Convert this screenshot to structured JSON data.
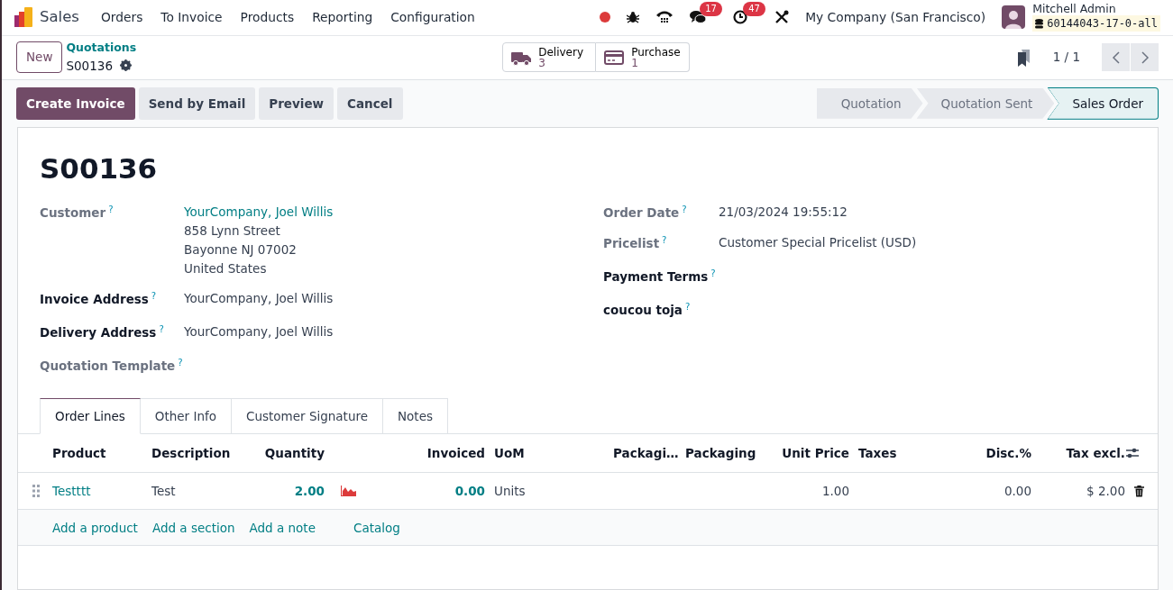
{
  "navbar": {
    "app_name": "Sales",
    "menu": [
      "Orders",
      "To Invoice",
      "Products",
      "Reporting",
      "Configuration"
    ],
    "messages_count": "17",
    "activities_count": "47",
    "company": "My Company (San Francisco)",
    "user_name": "Mitchell Admin",
    "database": "60144043-17-0-all"
  },
  "control_panel": {
    "new_button": "New",
    "breadcrumb": "Quotations",
    "record": "S00136",
    "smart_buttons": [
      {
        "kind": "delivery",
        "label": "Delivery",
        "count": "3"
      },
      {
        "kind": "purchase",
        "label": "Purchase",
        "count": "1"
      }
    ],
    "pager": "1 / 1"
  },
  "action_buttons": [
    {
      "label": "Create Invoice",
      "primary": true
    },
    {
      "label": "Send by Email",
      "primary": false
    },
    {
      "label": "Preview",
      "primary": false
    },
    {
      "label": "Cancel",
      "primary": false
    }
  ],
  "stages": [
    {
      "label": "Quotation",
      "selected": false
    },
    {
      "label": "Quotation Sent",
      "selected": false
    },
    {
      "label": "Sales Order",
      "selected": true
    }
  ],
  "sheet": {
    "title": "S00136",
    "left_fields": [
      {
        "label": "Customer",
        "help": "?",
        "required": false,
        "link": true,
        "value": [
          "YourCompany, Joel Willis",
          "858 Lynn Street",
          "Bayonne NJ 07002",
          "United States"
        ]
      },
      {
        "label": "Invoice Address",
        "help": "?",
        "required": true,
        "link": false,
        "value": [
          "YourCompany, Joel Willis"
        ]
      },
      {
        "label": "Delivery Address",
        "help": "?",
        "required": true,
        "link": false,
        "value": [
          "YourCompany, Joel Willis"
        ]
      },
      {
        "label": "Quotation Template",
        "help": "?",
        "required": false
      }
    ],
    "right_fields": [
      {
        "label": "Order Date",
        "help": "?",
        "required": false,
        "link": false,
        "value": [
          "21/03/2024 19:55:12"
        ]
      },
      {
        "label": "Pricelist",
        "help": "?",
        "required": false,
        "link": false,
        "value": [
          "Customer Special Pricelist (USD)"
        ]
      },
      {
        "label": "Payment Terms",
        "help": "?",
        "required": true
      },
      {
        "label": "coucou toja",
        "help": "?",
        "required": true
      }
    ],
    "tabs": [
      {
        "label": "Order Lines",
        "selected": true
      },
      {
        "label": "Other Info",
        "selected": false
      },
      {
        "label": "Customer Signature",
        "selected": false
      },
      {
        "label": "Notes",
        "selected": false
      }
    ],
    "table": {
      "columns": [
        "Product",
        "Description",
        "Quantity",
        "Invoiced",
        "UoM",
        "Packagi…",
        "Packaging",
        "Unit Price",
        "Taxes",
        "Disc.%",
        "Tax excl."
      ],
      "rows": [
        {
          "cells": [
            {
              "text": "Testttt"
            },
            {
              "text": "Test"
            },
            {
              "text": "2.00",
              "forecast_chart": true
            },
            {
              "text": "0.00"
            },
            {
              "text": "Units"
            },
            null,
            null,
            {
              "text": "1.00"
            },
            null,
            {
              "text": "0.00"
            },
            {
              "text": "$ 2.00"
            }
          ]
        }
      ],
      "add_links": [
        "Add a product",
        "Add a section",
        "Add a note",
        "Catalog"
      ]
    }
  }
}
